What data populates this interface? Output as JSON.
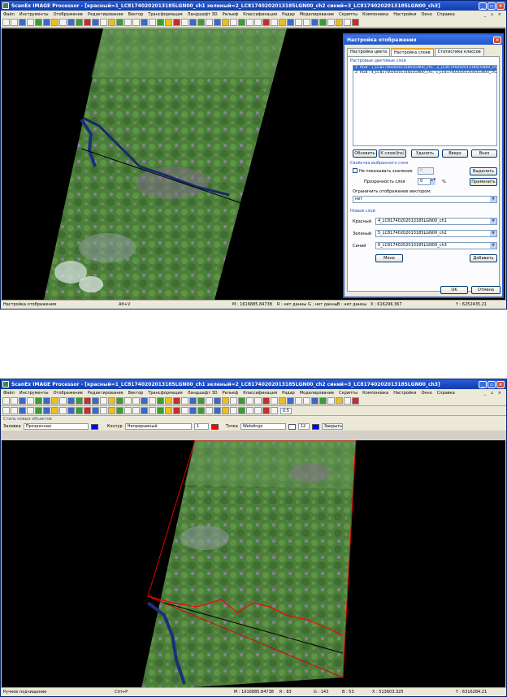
{
  "window1": {
    "title": "ScanEx IMAGE Processor - [красный=1_LC81740202013185LGN00_ch1  зеленый=2_LC81740202013185LGN00_ch2  синий=3_LC81740202013185LGN00_ch3]",
    "menu": [
      "Файл",
      "Инструменты",
      "Отображение",
      "Редактирование",
      "Вектор",
      "Трансформация",
      "Ландшафт 3D",
      "Рельеф",
      "Классификация",
      "Радар",
      "Моделирование",
      "Скрипты",
      "Компоновка",
      "Настройки",
      "Окно",
      "Справка"
    ],
    "mdi_controls": "_ ▫ ×",
    "status": {
      "mode": "Настройка отображения",
      "keys": "Alt+V",
      "m": "M : 1616885.84738",
      "r": "R : нет данны",
      "g": "G : нет данны",
      "b": "B : нет данны",
      "x": "X : 616296.367",
      "y": "Y : 6252435.21"
    },
    "dialog": {
      "title": "Настройка отображения",
      "tabs": [
        "Настройка цвета",
        "Настройка слоев",
        "Статистика классов"
      ],
      "active_tab": 1,
      "raster_layers_label": "Растровые цветовые слои",
      "layers": [
        "1. RGB : 1_LC81740202013185LGN00_ch1 , 2_LC81740202013185LGN00_ch2, 3_LC81740202013185LGN",
        "2. RGB : 4_LC81740202013185LGN00_ch1, 5_LC81740202013185LGN00_ch2, 6_LC81740202013185LGN"
      ],
      "buttons": {
        "refresh": "Обновить",
        "to_layer": "К слою(Ins)",
        "delete": "Удалить",
        "up": "Вверх",
        "down": "Вниз",
        "select": "Выделить",
        "apply": "Применить",
        "mono": "Моно",
        "add": "Добавить",
        "ok": "OK",
        "cancel": "Отмена"
      },
      "selected_layer_props": "Свойства выбранного слоя",
      "no_show_value": "Не показывать значение",
      "no_show_value_input": "0",
      "transparency_label": "Прозрачность слоя",
      "transparency_value": "0",
      "percent": "%",
      "limit_label": "Ограничить отображение вектором:",
      "limit_value": "нет",
      "new_layer": "Новый слой",
      "red_label": "Красный",
      "red_value": "4_LC81740202013185LGN00_ch1",
      "green_label": "Зеленый",
      "green_value": "5_LC81740202013185LGN00_ch2",
      "blue_label": "Синий",
      "blue_value": "6_LC81740202013185LGN00_ch3"
    }
  },
  "window2": {
    "title": "ScanEx IMAGE Processor - [красный=1_LC81740202013185LGN00_ch1  зеленый=2_LC81740202013185LGN00_ch2  синий=3_LC81740202013185LGN00_ch3]",
    "menu": [
      "Файл",
      "Инструменты",
      "Отображение",
      "Редактирование",
      "Вектор",
      "Трансформация",
      "Ландшафт 3D",
      "Рельеф",
      "Классификация",
      "Радар",
      "Моделирование",
      "Скрипты",
      "Компоновка",
      "Настройки",
      "Окно",
      "Справка"
    ],
    "mdi_controls": "_ ▫ ×",
    "zoom_value": "0.5",
    "style_label": "Стиль новых объектов",
    "fill_label": "Заливка",
    "fill_value": "Прозрачная",
    "fill_color": "#0000ff",
    "outline_label": "Контур",
    "outline_value": "Непрерывный",
    "outline_color": "#ff0000",
    "outline_width": "1",
    "point_label": "Точка",
    "point_value": "Webdings",
    "point_size": "12",
    "point_color": "#0000ff",
    "close_label": "Закрыть",
    "status": {
      "mode": "Ручное подчищение",
      "keys": "Ctrl+P",
      "m": "M : 1616885.84738",
      "r": "R : 83",
      "g": "G : 143",
      "b": "B : 53",
      "x": "X : 513603.325",
      "y": "Y : 6316284.21"
    }
  }
}
